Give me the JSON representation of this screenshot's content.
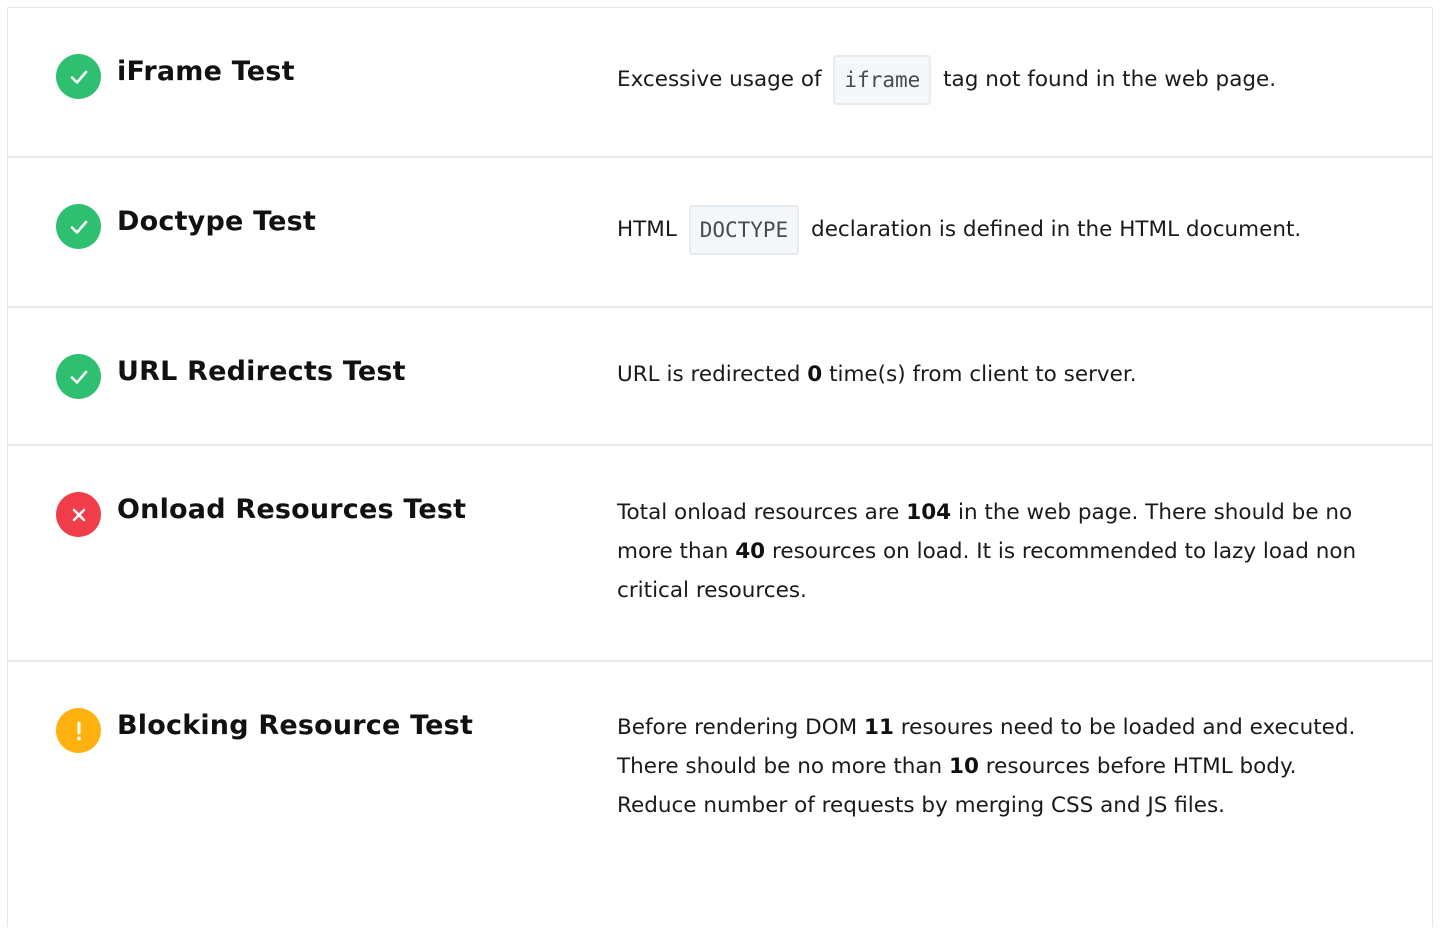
{
  "tests": [
    {
      "title": "iFrame Test",
      "status": "pass",
      "status_icon": "check-icon",
      "desc": {
        "before": "Excessive usage of",
        "code": "iframe",
        "after": "tag not found in the web page."
      }
    },
    {
      "title": "Doctype Test",
      "status": "pass",
      "status_icon": "check-icon",
      "desc": {
        "before": "HTML",
        "code": "DOCTYPE",
        "after": "declaration is defined in the HTML document."
      }
    },
    {
      "title": "URL Redirects Test",
      "status": "pass",
      "status_icon": "check-icon",
      "desc": {
        "t1": "URL is redirected ",
        "n1": "0",
        "t2": " time(s) from client to server."
      }
    },
    {
      "title": "Onload Resources Test",
      "status": "fail",
      "status_icon": "cross-icon",
      "desc": {
        "t1": "Total onload resources are ",
        "n1": "104",
        "t2": " in the web page. There should be no more than ",
        "n2": "40",
        "t3": " resources on load. It is recommended to lazy load non critical resources."
      }
    },
    {
      "title": "Blocking Resource Test",
      "status": "warning",
      "status_icon": "exclamation-icon",
      "desc": {
        "t1": "Before rendering DOM ",
        "n1": "11",
        "t2": " resoures need to be loaded and executed. There should be no more than ",
        "n2": "10",
        "t3": " resources before HTML body. Reduce number of requests by merging CSS and JS files."
      }
    }
  ],
  "colors": {
    "pass": "#2fbf71",
    "fail": "#ef3d4a",
    "warning": "#ffb20f",
    "border": "#e6e8ea",
    "code_bg": "#f5f8fb"
  }
}
